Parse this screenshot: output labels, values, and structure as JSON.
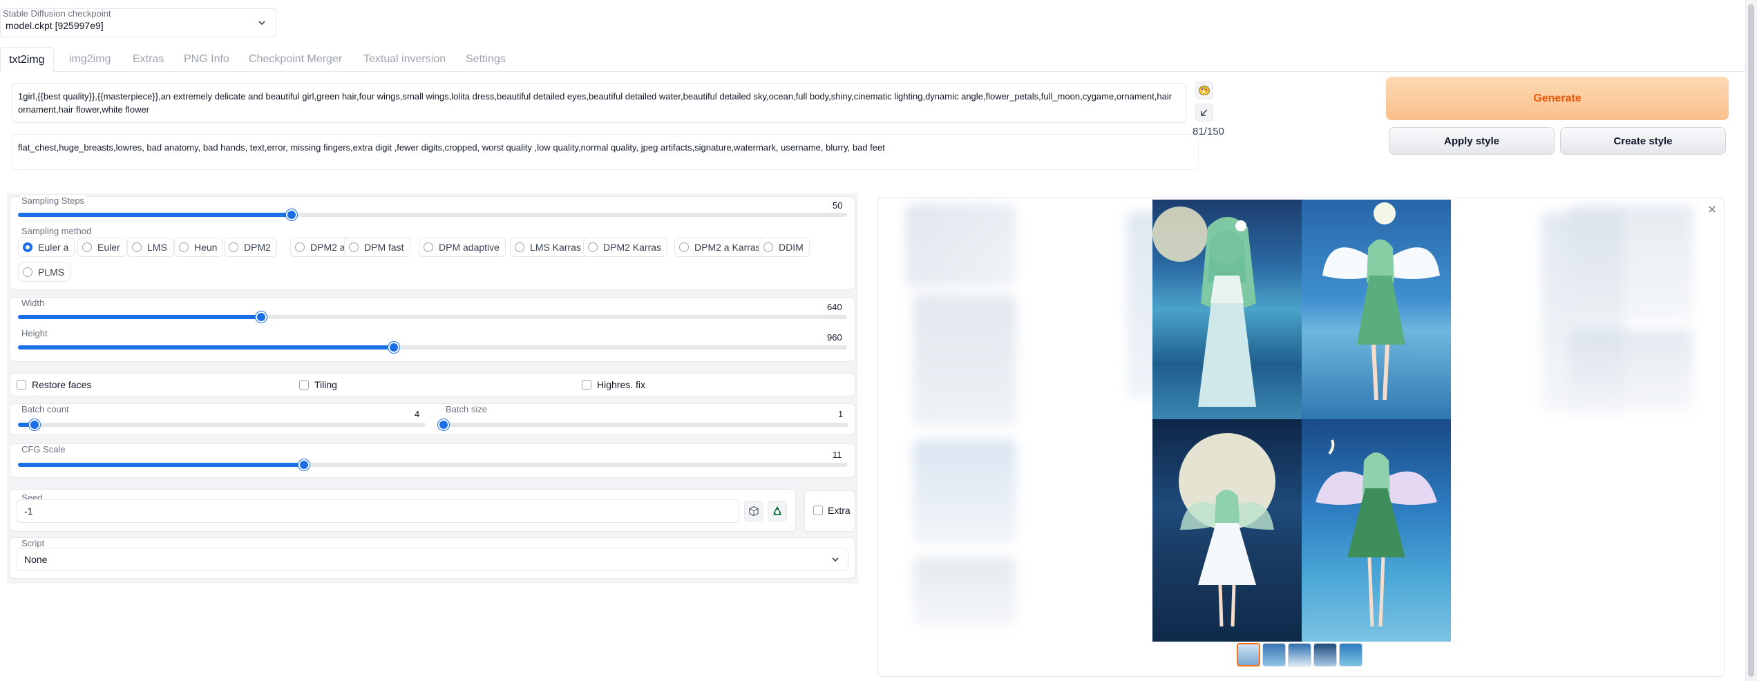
{
  "checkpoint": {
    "label": "Stable Diffusion checkpoint",
    "value": "model.ckpt [925997e9]"
  },
  "tabs": [
    {
      "label": "txt2img",
      "active": true
    },
    {
      "label": "img2img"
    },
    {
      "label": "Extras"
    },
    {
      "label": "PNG Info"
    },
    {
      "label": "Checkpoint Merger"
    },
    {
      "label": "Textual inversion"
    },
    {
      "label": "Settings"
    }
  ],
  "prompt": {
    "positive": "1girl,{{best quality}},{{masterpiece}},an extremely delicate and beautiful girl,green hair,four wings,small wings,lolita dress,beautiful detailed eyes,beautiful detailed water,beautiful detailed sky,ocean,full body,shiny,cinematic lighting,dynamic angle,flower_petals,full_moon,cygame,ornament,hair ornament,hair flower,white flower",
    "negative": "flat_chest,huge_breasts,lowres, bad anatomy, bad hands, text,error, missing fingers,extra digit ,fewer digits,cropped, worst quality ,low quality,normal quality, jpeg artifacts,signature,watermark, username, blurry, bad feet",
    "token_count": "81/150"
  },
  "actions": {
    "generate": "Generate",
    "apply_style": "Apply style",
    "create_style": "Create style"
  },
  "sampling": {
    "steps_label": "Sampling Steps",
    "steps_value": "50",
    "steps_fraction": 0.33,
    "method_label": "Sampling method",
    "methods": [
      "Euler a",
      "Euler",
      "LMS",
      "Heun",
      "DPM2",
      "DPM2 a",
      "DPM fast",
      "DPM adaptive",
      "LMS Karras",
      "DPM2 Karras",
      "DPM2 a Karras",
      "DDIM",
      "PLMS"
    ],
    "selected_method": "Euler a"
  },
  "dimensions": {
    "width_label": "Width",
    "width_value": "640",
    "width_fraction": 0.293,
    "height_label": "Height",
    "height_value": "960",
    "height_fraction": 0.453
  },
  "options": {
    "restore_faces": "Restore faces",
    "tiling": "Tiling",
    "highres_fix": "Highres. fix"
  },
  "batch": {
    "count_label": "Batch count",
    "count_value": "4",
    "count_fraction": 0.04,
    "size_label": "Batch size",
    "size_value": "1",
    "size_fraction": 0.0
  },
  "cfg": {
    "label": "CFG Scale",
    "value": "11",
    "fraction": 0.345
  },
  "seed": {
    "label": "Seed",
    "value": "-1",
    "extra_label": "Extra"
  },
  "script": {
    "label": "Script",
    "value": "None"
  },
  "gallery": {
    "thumbnail_count": 5,
    "selected_thumbnail": 0
  },
  "colors": {
    "accent": "#1b6fe6",
    "generate_text": "#ea580c",
    "generate_bg": "#fbbf8a"
  }
}
